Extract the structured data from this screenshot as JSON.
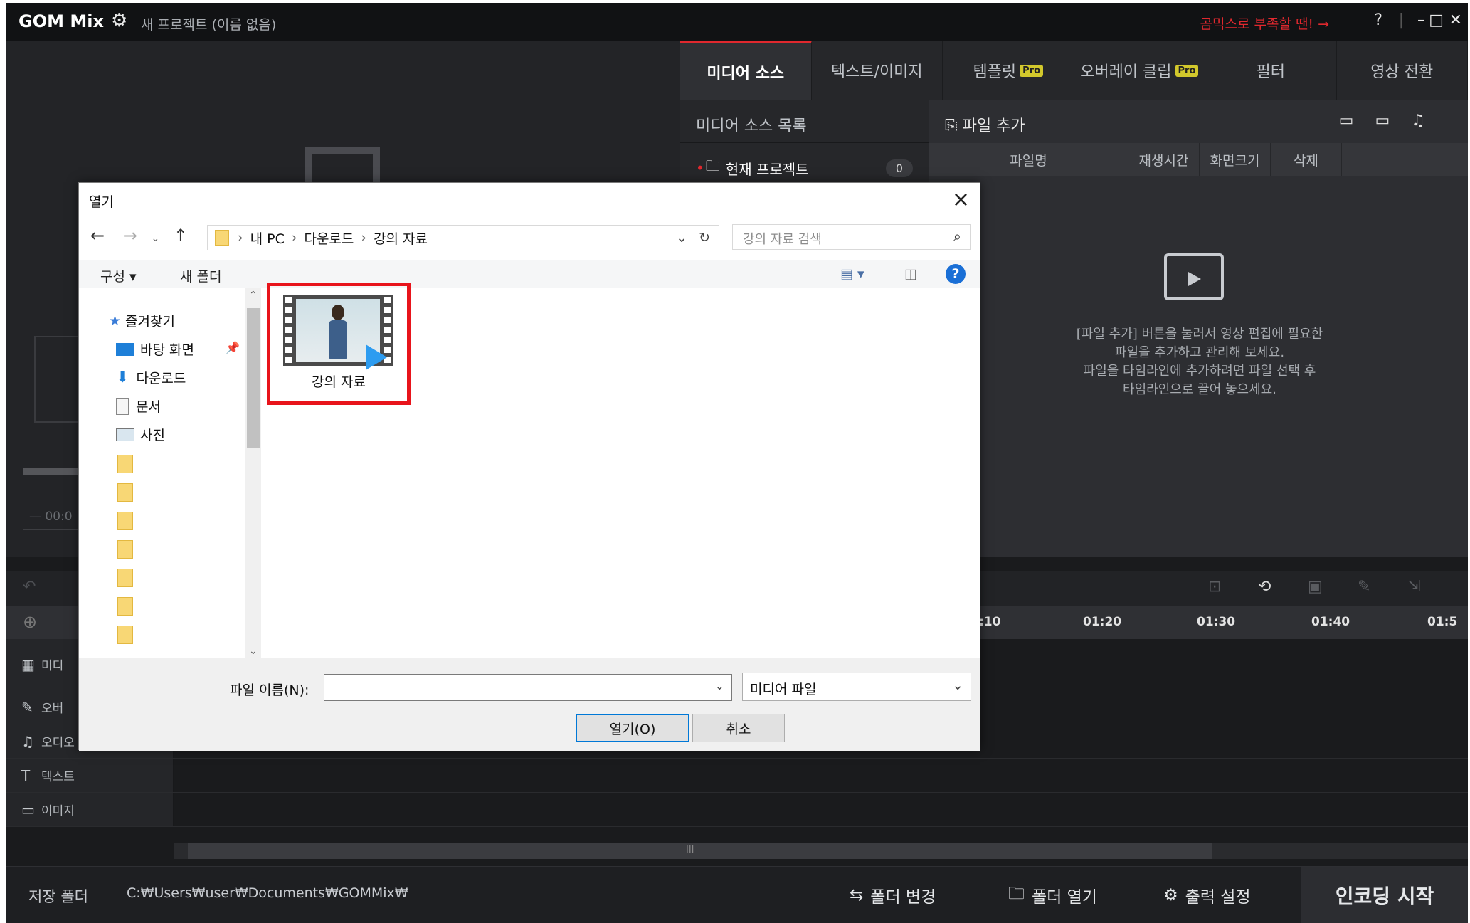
{
  "titlebar": {
    "logo": "GOM Mix",
    "project_title": "새 프로젝트 (이름 없음)",
    "promo": "곰믹스로 부족할 땐! →",
    "help": "?",
    "minimize": "–",
    "maximize": "□",
    "close": "✕"
  },
  "tabs": [
    {
      "label": "미디어 소스"
    },
    {
      "label": "텍스트/이미지"
    },
    {
      "label": "템플릿",
      "badge": "Pro"
    },
    {
      "label": "오버레이 클립",
      "badge": "Pro"
    },
    {
      "label": "필터"
    },
    {
      "label": "영상 전환"
    }
  ],
  "media": {
    "list_title": "미디어 소스 목록",
    "current_project": "현재 프로젝트",
    "count": "0",
    "add_file": "파일 추가",
    "columns": [
      "파일명",
      "재생시간",
      "화면크기",
      "삭제"
    ],
    "empty_text": [
      "[파일 추가] 버튼을 눌러서 영상 편집에 필요한",
      "파일을 추가하고 관리해 보세요.",
      "파일을 타임라인에 추가하려면 파일 선택 후",
      "타임라인으로 끌어 놓으세요."
    ]
  },
  "preview": {
    "time_partial": "00:0"
  },
  "timeline": {
    "ruler": [
      ":10",
      "01:20",
      "01:30",
      "01:40",
      "01:5"
    ],
    "tracks": [
      {
        "label": "미디",
        "icon": "▦"
      },
      {
        "label": "오버",
        "icon": "✎"
      },
      {
        "label": "오디오",
        "icon": "♫"
      },
      {
        "label": "텍스트",
        "icon": "T"
      },
      {
        "label": "이미지",
        "icon": "▭"
      }
    ],
    "scroll_grip": "III"
  },
  "bottombar": {
    "save_label": "저장 폴더",
    "save_path": "C:₩Users₩user₩Documents₩GOMMix₩",
    "change_folder": "폴더 변경",
    "open_folder": "폴더 열기",
    "output_settings": "출력 설정",
    "encode": "인코딩 시작"
  },
  "dialog": {
    "title": "열기",
    "path": [
      "내 PC",
      "다운로드",
      "강의 자료"
    ],
    "search_placeholder": "강의 자료 검색",
    "organize": "구성 ▾",
    "new_folder": "새 폴더",
    "nav": {
      "favorites": "즐겨찾기",
      "items": [
        "바탕 화면",
        "다운로드",
        "문서",
        "사진"
      ]
    },
    "file": {
      "name": "강의 자료"
    },
    "filename_label": "파일 이름(N):",
    "filetype": "미디어 파일",
    "open_btn": "열기(O)",
    "cancel_btn": "취소"
  },
  "colors": {
    "accent": "#e0282e",
    "pro_badge": "#d2c82c",
    "dialog_focus": "#0078d7"
  }
}
